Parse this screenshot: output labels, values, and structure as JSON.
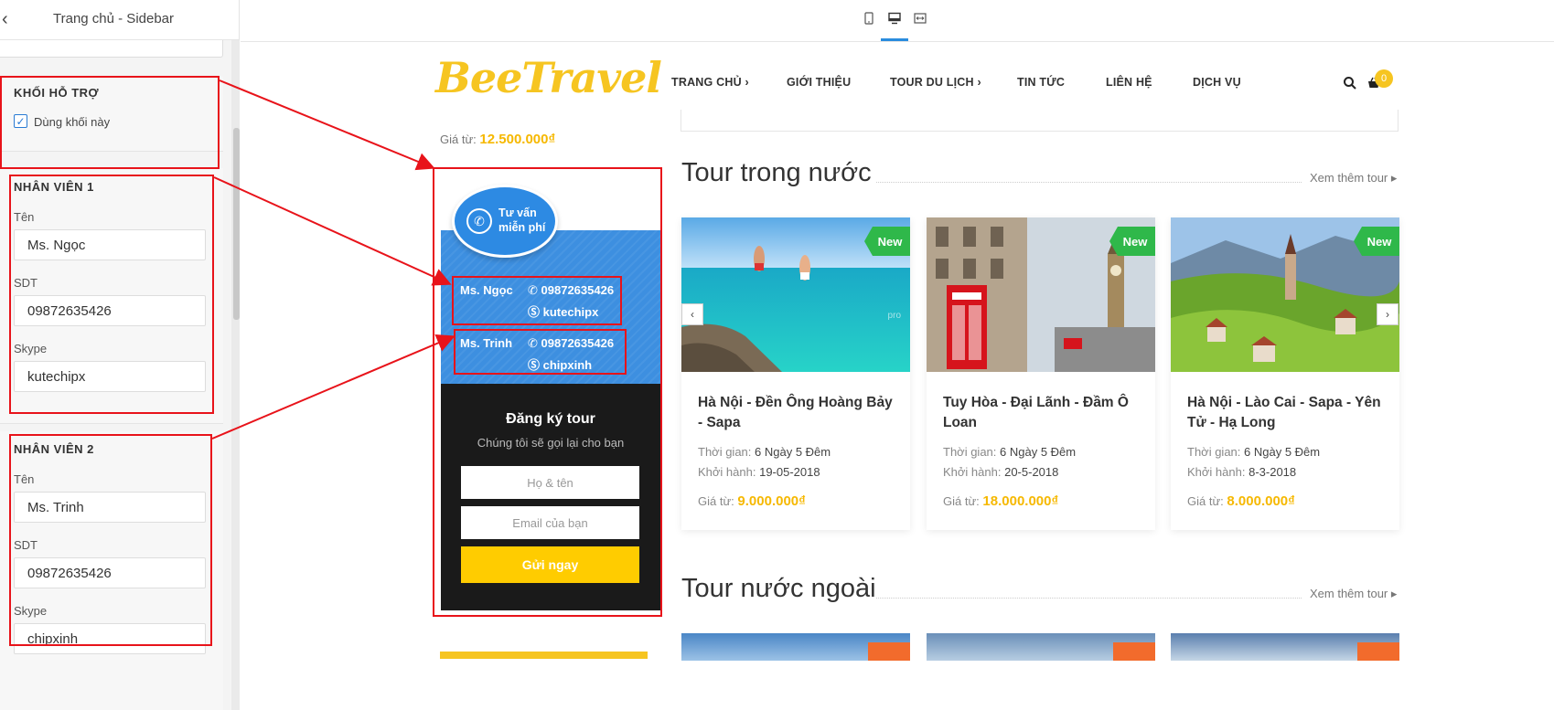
{
  "sidebar": {
    "title": "Trang chủ - Sidebar",
    "support_section_title": "KHỐI HỖ TRỢ",
    "use_block_label": "Dùng khối này",
    "staff1": {
      "title": "NHÂN VIÊN 1",
      "name_label": "Tên",
      "name_value": "Ms. Ngọc",
      "phone_label": "SDT",
      "phone_value": "09872635426",
      "skype_label": "Skype",
      "skype_value": "kutechipx"
    },
    "staff2": {
      "title": "NHÂN VIÊN 2",
      "name_label": "Tên",
      "name_value": "Ms. Trinh",
      "phone_label": "SDT",
      "phone_value": "09872635426",
      "skype_label": "Skype",
      "skype_value": "chipxinh"
    }
  },
  "site": {
    "logo": "BeeTravel",
    "nav": [
      {
        "label": "TRANG CHỦ",
        "chevron": "›"
      },
      {
        "label": "GIỚI THIỆU"
      },
      {
        "label": "TOUR DU LỊCH",
        "chevron": "›"
      },
      {
        "label": "TIN TỨC"
      },
      {
        "label": "LIÊN HỆ"
      },
      {
        "label": "DỊCH VỤ"
      }
    ],
    "cart_count": "0"
  },
  "left_col": {
    "price_prefix": "Giá từ:",
    "price_value": "12.500.000₫",
    "support": {
      "bubble_line1": "Tư vấn",
      "bubble_line2": "miễn phí",
      "staff": [
        {
          "name": "Ms. Ngọc",
          "phone": "09872635426",
          "skype": "kutechipx"
        },
        {
          "name": "Ms. Trinh",
          "phone": "09872635426",
          "skype": "chipxinh"
        }
      ]
    },
    "register": {
      "title": "Đăng ký tour",
      "subtitle": "Chúng tôi sẽ gọi lại cho bạn",
      "name_placeholder": "Họ & tên",
      "email_placeholder": "Email của bạn",
      "submit": "Gửi ngay"
    }
  },
  "domestic": {
    "title": "Tour trong nước",
    "see_more": "Xem thêm tour",
    "tours": [
      {
        "badge": "New",
        "title": "Hà Nội - Đền Ông Hoàng Bảy - Sapa",
        "time_label": "Thời gian:",
        "time": "6 Ngày 5 Đêm",
        "depart_label": "Khởi hành:",
        "depart": "19-05-2018",
        "price_label": "Giá từ:",
        "price": "9.000.000₫"
      },
      {
        "badge": "New",
        "title": "Tuy Hòa - Đại Lãnh - Đầm Ô Loan",
        "time_label": "Thời gian:",
        "time": "6 Ngày 5 Đêm",
        "depart_label": "Khởi hành:",
        "depart": "20-5-2018",
        "price_label": "Giá từ:",
        "price": "18.000.000₫"
      },
      {
        "badge": "New",
        "title": "Hà Nội - Lào Cai - Sapa - Yên Tử - Hạ Long",
        "time_label": "Thời gian:",
        "time": "6 Ngày 5 Đêm",
        "depart_label": "Khởi hành:",
        "depart": "8-3-2018",
        "price_label": "Giá từ:",
        "price": "8.000.000₫"
      }
    ]
  },
  "foreign": {
    "title": "Tour nước ngoài",
    "see_more": "Xem thêm tour"
  },
  "colors": {
    "brand_yellow": "#f6c521",
    "support_blue": "#3d8fe0",
    "badge_green": "#2fb84a",
    "annotation_red": "#e8131a"
  }
}
